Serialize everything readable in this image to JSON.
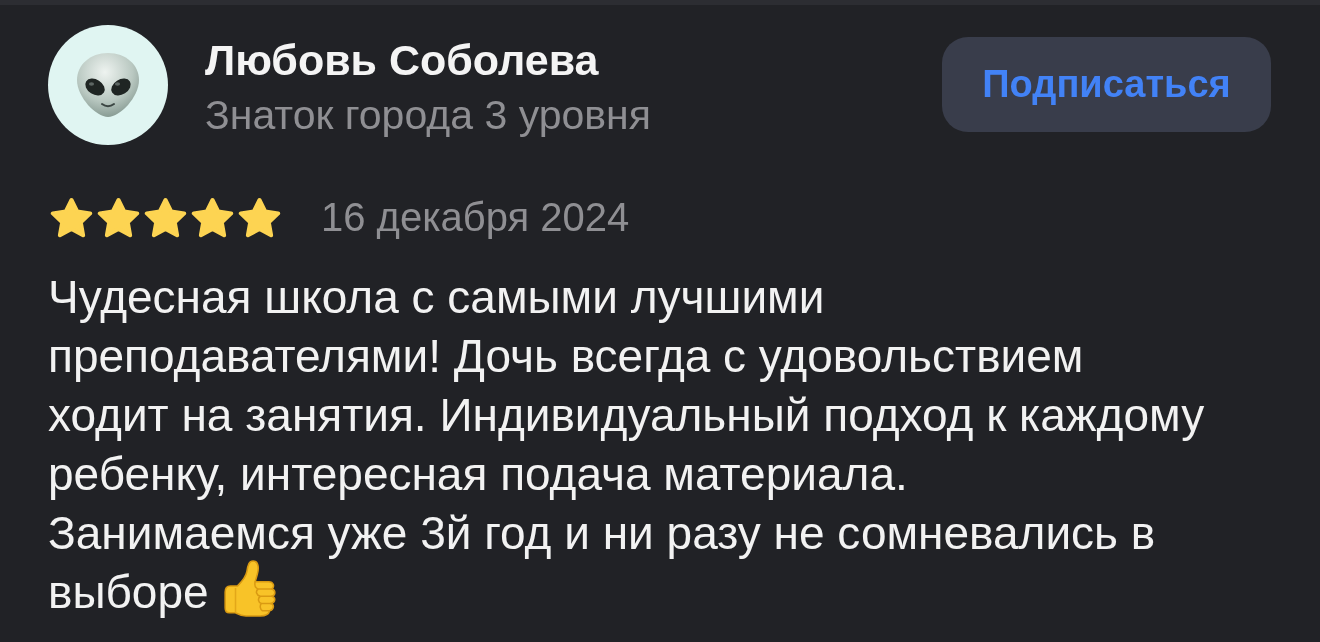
{
  "author": {
    "name": "Любовь Соболева",
    "rank": "Знаток города 3 уровня"
  },
  "subscribe_button": {
    "label": "Подписаться"
  },
  "review": {
    "stars": 5,
    "date": "16 декабря 2024",
    "lines": [
      "Чудесная школа с самыми лучшими",
      "преподавателями! Дочь всегда с удовольствием",
      "ходит на занятия. Индивидуальный подход к каждому",
      "ребенку, интересная подача материала.",
      "Занимаемся уже 3й год и ни разу не сомневались в",
      "выборе"
    ]
  }
}
